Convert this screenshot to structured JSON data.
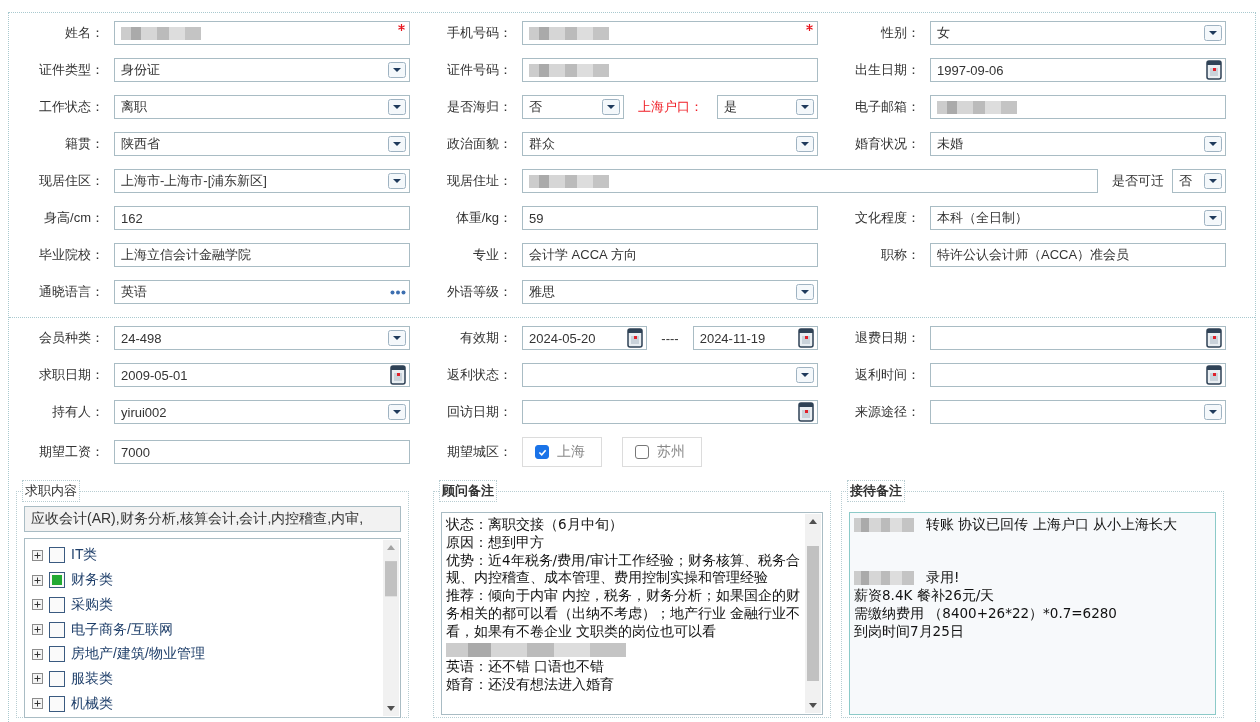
{
  "personal": {
    "rows": [
      {
        "cells": [
          {
            "label": "姓名：",
            "controls": [
              {
                "kind": "text",
                "redacted": true,
                "required": true
              }
            ]
          },
          {
            "label": "手机号码：",
            "controls": [
              {
                "kind": "text",
                "redacted": true,
                "required": true
              }
            ]
          },
          {
            "label": "性别：",
            "controls": [
              {
                "kind": "select",
                "value": "女"
              }
            ]
          }
        ]
      },
      {
        "cells": [
          {
            "label": "证件类型：",
            "controls": [
              {
                "kind": "select",
                "value": "身份证"
              }
            ]
          },
          {
            "label": "证件号码：",
            "controls": [
              {
                "kind": "text",
                "redacted": true
              }
            ]
          },
          {
            "label": "出生日期：",
            "controls": [
              {
                "kind": "date",
                "value": "1997-09-06"
              }
            ]
          }
        ]
      },
      {
        "cells": [
          {
            "label": "工作状态：",
            "controls": [
              {
                "kind": "select",
                "value": "离职"
              }
            ]
          },
          {
            "label": "是否海归：",
            "controls": [
              {
                "kind": "select",
                "value": "否"
              },
              {
                "kind": "label",
                "text": "上海户口：",
                "emphasized": true
              },
              {
                "kind": "select",
                "value": "是"
              }
            ]
          },
          {
            "label": "电子邮箱：",
            "controls": [
              {
                "kind": "text",
                "redacted": true
              }
            ]
          }
        ]
      },
      {
        "cells": [
          {
            "label": "籍贯：",
            "controls": [
              {
                "kind": "select",
                "value": "陕西省"
              }
            ]
          },
          {
            "label": "政治面貌：",
            "controls": [
              {
                "kind": "select",
                "value": "群众"
              }
            ]
          },
          {
            "label": "婚育状况：",
            "controls": [
              {
                "kind": "select",
                "value": "未婚"
              }
            ]
          }
        ]
      },
      {
        "cells": [
          {
            "label": "现居住区：",
            "controls": [
              {
                "kind": "select",
                "value": "上海市-上海市-[浦东新区]"
              }
            ]
          },
          {
            "label": "现居住址：",
            "wide": true,
            "controls": [
              {
                "kind": "text",
                "redacted": true
              },
              {
                "kind": "label",
                "text": "是否可迁",
                "emphasized": false
              },
              {
                "kind": "select",
                "value": "否"
              }
            ]
          }
        ]
      },
      {
        "cells": [
          {
            "label": "身高/cm：",
            "controls": [
              {
                "kind": "text",
                "value": "162"
              }
            ]
          },
          {
            "label": "体重/kg：",
            "controls": [
              {
                "kind": "text",
                "value": "59"
              }
            ]
          },
          {
            "label": "文化程度：",
            "controls": [
              {
                "kind": "select",
                "value": "本科（全日制）"
              }
            ]
          }
        ]
      },
      {
        "cells": [
          {
            "label": "毕业院校：",
            "controls": [
              {
                "kind": "text",
                "value": "上海立信会计金融学院"
              }
            ]
          },
          {
            "label": "专业：",
            "controls": [
              {
                "kind": "text",
                "value": "会计学 ACCA 方向"
              }
            ]
          },
          {
            "label": "职称：",
            "controls": [
              {
                "kind": "text",
                "value": "特许公认会计师（ACCA）准会员"
              }
            ]
          }
        ]
      },
      {
        "cells": [
          {
            "label": "通晓语言：",
            "controls": [
              {
                "kind": "picker",
                "value": "英语"
              }
            ]
          },
          {
            "label": "外语等级：",
            "controls": [
              {
                "kind": "select",
                "value": "雅思"
              }
            ]
          }
        ]
      }
    ]
  },
  "membership": {
    "rows": [
      {
        "cells": [
          {
            "label": "会员种类：",
            "controls": [
              {
                "kind": "select",
                "value": "24-498"
              }
            ]
          },
          {
            "label": "有效期：",
            "controls": [
              {
                "kind": "date",
                "value": "2024-05-20"
              },
              {
                "kind": "label",
                "text": "----",
                "emphasized": false
              },
              {
                "kind": "date",
                "value": "2024-11-19"
              }
            ]
          },
          {
            "label": "退费日期：",
            "controls": [
              {
                "kind": "date"
              }
            ]
          }
        ]
      },
      {
        "cells": [
          {
            "label": "求职日期：",
            "controls": [
              {
                "kind": "date",
                "value": "2009-05-01"
              }
            ]
          },
          {
            "label": "返利状态：",
            "controls": [
              {
                "kind": "select"
              }
            ]
          },
          {
            "label": "返利时间：",
            "controls": [
              {
                "kind": "date"
              }
            ]
          }
        ]
      },
      {
        "cells": [
          {
            "label": "持有人：",
            "controls": [
              {
                "kind": "select",
                "value": "yirui002"
              }
            ]
          },
          {
            "label": "回访日期：",
            "controls": [
              {
                "kind": "date"
              }
            ]
          },
          {
            "label": "来源途径：",
            "controls": [
              {
                "kind": "select"
              }
            ]
          }
        ]
      },
      {
        "cells": [
          {
            "label": "期望工资：",
            "controls": [
              {
                "kind": "text",
                "value": "7000"
              }
            ]
          },
          {
            "label": "期望城区：",
            "controls": [
              {
                "kind": "checkbox",
                "text": "上海",
                "checked": true
              },
              {
                "kind": "checkbox",
                "text": "苏州",
                "checked": false
              }
            ]
          }
        ]
      }
    ]
  },
  "job_panel": {
    "title": "求职内容",
    "emphasized": false,
    "summary": "应收会计(AR),财务分析,核算会计,会计,内控稽查,内审,",
    "tree": [
      {
        "label": "IT类",
        "checked": false,
        "expanded": false
      },
      {
        "label": "财务类",
        "checked": true,
        "expanded": false
      },
      {
        "label": "采购类",
        "checked": false,
        "expanded": false
      },
      {
        "label": "电子商务/互联网",
        "checked": false,
        "expanded": false
      },
      {
        "label": "房地产/建筑/物业管理",
        "checked": false,
        "expanded": false
      },
      {
        "label": "服装类",
        "checked": false,
        "expanded": false
      },
      {
        "label": "机械类",
        "checked": false,
        "expanded": false
      }
    ]
  },
  "consultant_panel": {
    "title": "顾问备注",
    "emphasized": true,
    "lines": [
      {
        "kind": "text",
        "text": "状态：离职交接（6月中旬）"
      },
      {
        "kind": "text",
        "text": "原因：想到甲方"
      },
      {
        "kind": "text",
        "text": "优势：近4年税务/费用/审计工作经验；财务核算、税务合规、内控稽查、成本管理、费用控制实操和管理经验"
      },
      {
        "kind": "text",
        "text": "推荐：倾向于内审 内控，税务，财务分析；如果国企的财务相关的都可以看（出纳不考虑）；地产行业 金融行业不看，如果有不卷企业 文职类的岗位也可以看"
      },
      {
        "kind": "redacted"
      },
      {
        "kind": "text",
        "text": "英语：还不错 口语也不错"
      },
      {
        "kind": "text",
        "text": "婚育：还没有想法进入婚育"
      }
    ]
  },
  "reception_panel": {
    "title": "接待备注",
    "emphasized": true,
    "lines": [
      {
        "kind": "redacted_text",
        "text": "转账 协议已回传 上海户口 从小上海长大"
      },
      {
        "kind": "blank"
      },
      {
        "kind": "blank"
      },
      {
        "kind": "redacted_text",
        "text": "录用!"
      },
      {
        "kind": "text",
        "text": "薪资8.4K 餐补26元/天"
      },
      {
        "kind": "text",
        "text": "需缴纳费用 （8400+26*22）*0.7=6280"
      },
      {
        "kind": "text",
        "text": "到岗时间7月25日"
      }
    ]
  }
}
